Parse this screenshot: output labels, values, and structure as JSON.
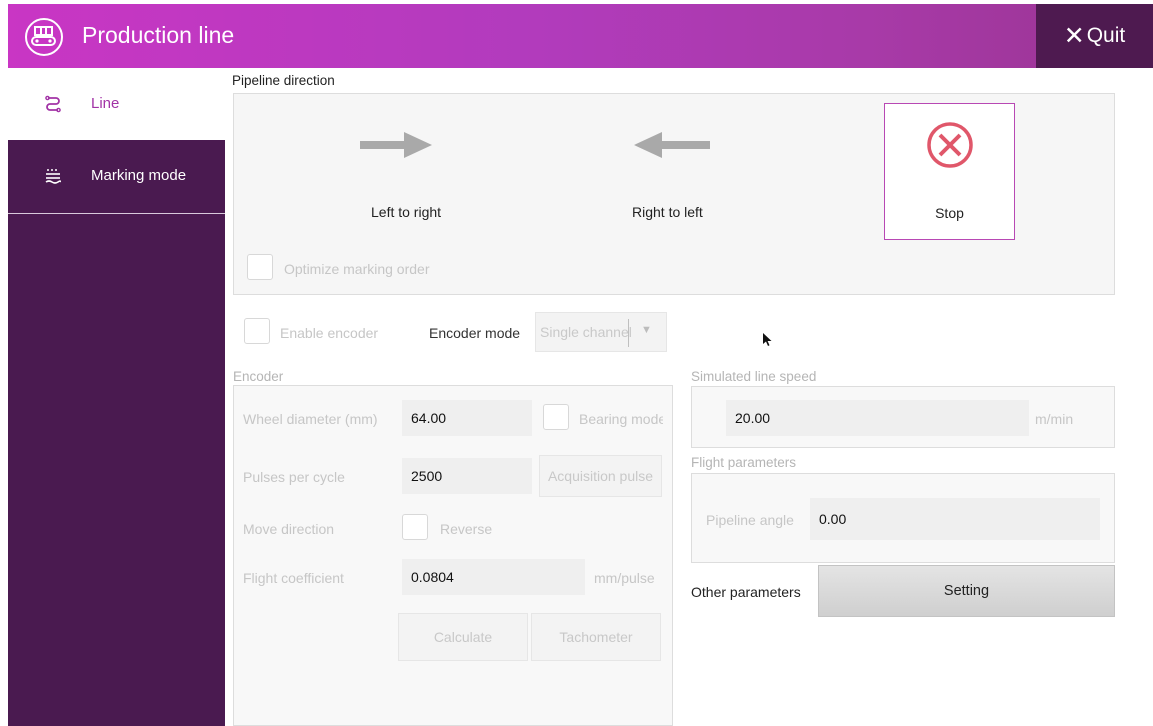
{
  "header": {
    "title": "Production line",
    "quit_label": "Quit",
    "icon": "conveyor-icon",
    "close_icon": "x-icon"
  },
  "sidebar": {
    "items": [
      {
        "label": "Line",
        "icon": "line-route-icon",
        "active": true
      },
      {
        "label": "Marking mode",
        "icon": "marking-mode-icon",
        "active": false
      }
    ]
  },
  "pipeline": {
    "title": "Pipeline direction",
    "left_to_right": "Left to right",
    "right_to_left": "Right to left",
    "stop": "Stop",
    "optimize_label": "Optimize marking order"
  },
  "encoder": {
    "enable_label": "Enable encoder",
    "mode_label": "Encoder mode",
    "mode_value": "Single channel",
    "section_title": "Encoder",
    "wheel_diameter_label": "Wheel diameter (mm)",
    "wheel_diameter_value": "64.00",
    "bearing_label": "Bearing mode",
    "pulses_label": "Pulses per cycle",
    "pulses_value": "2500",
    "acquisition_label": "Acquisition pulse",
    "move_direction_label": "Move direction",
    "reverse_label": "Reverse",
    "flight_coef_label": "Flight coefficient",
    "flight_coef_value": "0.0804",
    "flight_coef_unit": "mm/pulse",
    "calculate_label": "Calculate",
    "tachometer_label": "Tachometer"
  },
  "simulated": {
    "title": "Simulated line speed",
    "value": "20.00",
    "unit": "m/min"
  },
  "flight": {
    "title": "Flight parameters",
    "angle_label": "Pipeline angle",
    "angle_value": "0.00"
  },
  "other": {
    "label": "Other parameters",
    "setting_label": "Setting"
  },
  "colors": {
    "accent": "#a233a6",
    "sidebar": "#4a1a50",
    "quit_bg": "#4e1a50",
    "stop_icon": "#e0576a"
  }
}
